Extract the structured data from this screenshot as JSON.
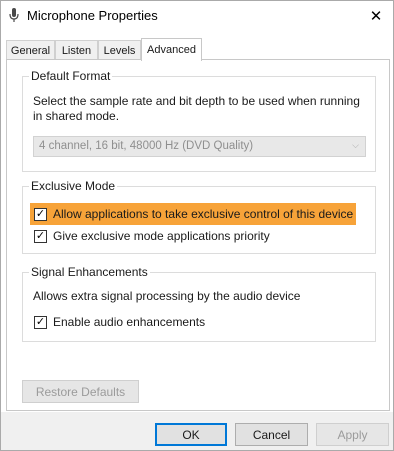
{
  "window": {
    "title": "Microphone Properties",
    "close_symbol": "✕"
  },
  "tabs": [
    {
      "label": "General"
    },
    {
      "label": "Listen"
    },
    {
      "label": "Levels"
    },
    {
      "label": "Advanced"
    }
  ],
  "default_format": {
    "legend": "Default Format",
    "description": "Select the sample rate and bit depth to be used when running in shared mode.",
    "selected_value": "4 channel, 16 bit, 48000 Hz (DVD Quality)",
    "dropdown_arrow": "⌵"
  },
  "exclusive_mode": {
    "legend": "Exclusive Mode",
    "options": [
      {
        "label": "Allow applications to take exclusive control of this device",
        "checked": true,
        "highlighted": true
      },
      {
        "label": "Give exclusive mode applications priority",
        "checked": true,
        "highlighted": false
      }
    ]
  },
  "signal_enhancements": {
    "legend": "Signal Enhancements",
    "description": "Allows extra signal processing by the audio device",
    "options": [
      {
        "label": "Enable audio enhancements",
        "checked": true
      }
    ]
  },
  "buttons": {
    "restore_defaults": "Restore Defaults",
    "ok": "OK",
    "cancel": "Cancel",
    "apply": "Apply"
  },
  "colors": {
    "highlight": "#f7a339",
    "default_button_border": "#0078d7"
  },
  "check_symbol": "✓"
}
